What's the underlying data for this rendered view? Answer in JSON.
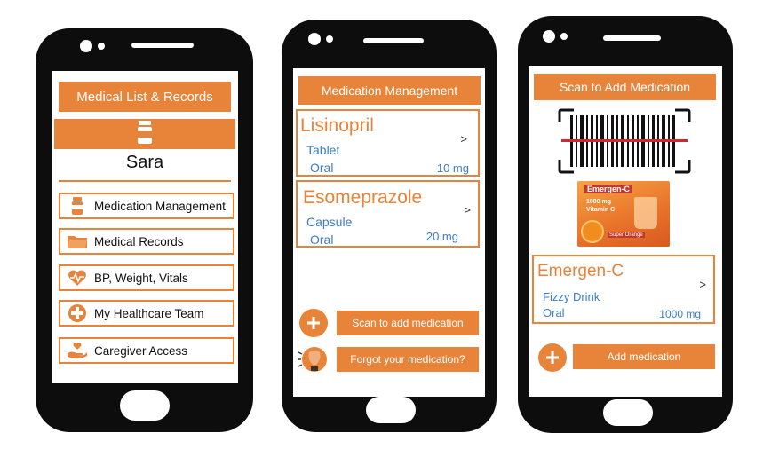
{
  "colors": {
    "accent": "#E8843A",
    "link": "#3B7DC4",
    "phone": "#0d0d0d"
  },
  "screen1": {
    "title": "Medical List & Records",
    "user_name": "Sara",
    "user_icon": "pill-bottle-icon",
    "menu": [
      {
        "label": "Medication Management",
        "icon": "pill-bottle-icon"
      },
      {
        "label": "Medical Records",
        "icon": "folder-icon"
      },
      {
        "label": "BP, Weight, Vitals",
        "icon": "heartbeat-icon"
      },
      {
        "label": "My Healthcare Team",
        "icon": "medical-cross-icon"
      },
      {
        "label": "Caregiver Access",
        "icon": "hand-heart-icon"
      }
    ]
  },
  "screen2": {
    "title": "Medication Management",
    "meds": [
      {
        "name": "Lisinopril",
        "form": "Tablet",
        "route": "Oral",
        "dose": "10 mg",
        "chevron": ">"
      },
      {
        "name": "Esomeprazole",
        "form": "Capsule",
        "route": "Oral",
        "dose": "20 mg",
        "chevron": ">"
      }
    ],
    "scan_button": "Scan to add medication",
    "forgot_button": "Forgot your medication?",
    "plus_icon": "plus-icon",
    "brain_icon": "brain-lightbulb-icon"
  },
  "screen3": {
    "title": "Scan to Add Medication",
    "barcode_icon": "barcode-scanner-icon",
    "product": {
      "brand_line": "Emergen-C",
      "dose_line": "1000 mg",
      "vitamin_line": "Vitamin C",
      "flavor_line": "Super Orange"
    },
    "med": {
      "name": "Emergen-C",
      "form": "Fizzy Drink",
      "route": "Oral",
      "dose": "1000 mg",
      "chevron": ">"
    },
    "add_button": "Add medication"
  }
}
